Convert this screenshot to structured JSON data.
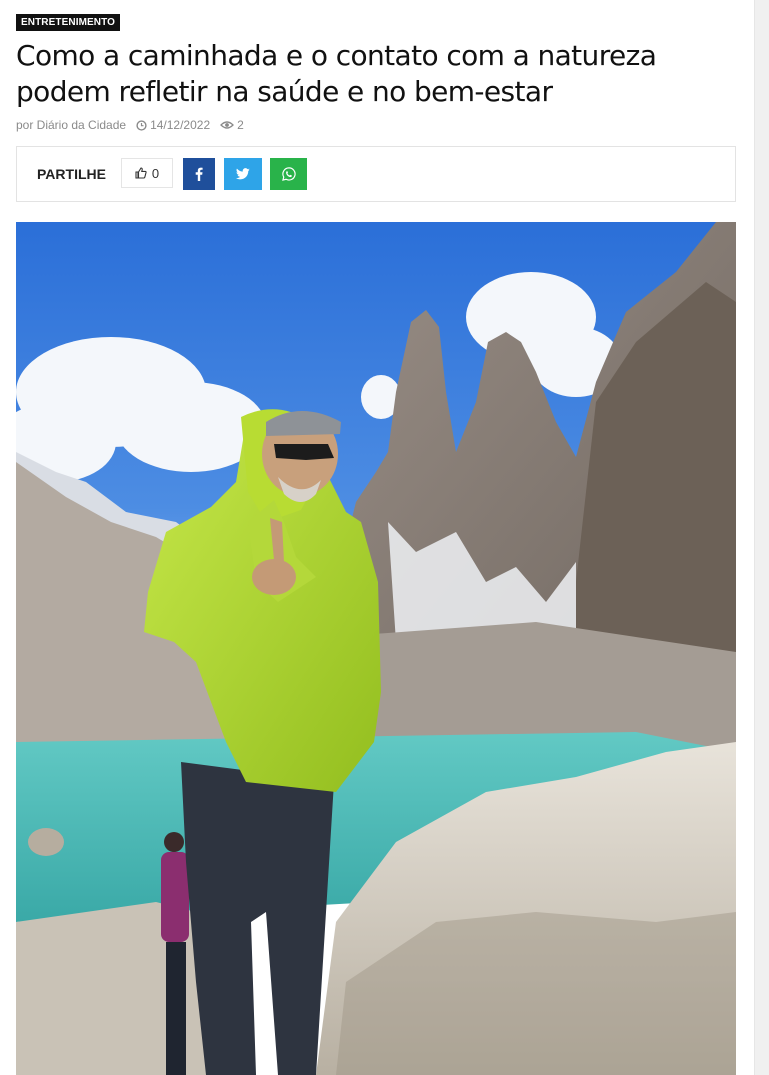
{
  "article": {
    "category": "ENTRETENIMENTO",
    "title": "Como a caminhada e o contato com a natureza podem refletir na saúde e no bem-estar",
    "author": "por Diário da Cidade",
    "date": "14/12/2022",
    "views": "2"
  },
  "share": {
    "label": "PARTILHE",
    "likes": "0",
    "buttons": [
      {
        "network": "facebook",
        "icon": "facebook-icon",
        "color": "#1f4f9b"
      },
      {
        "network": "twitter",
        "icon": "twitter-icon",
        "color": "#2ea4e8"
      },
      {
        "network": "whatsapp",
        "icon": "whatsapp-icon",
        "color": "#29b34a"
      }
    ]
  },
  "hero_image": {
    "subject": "hiker-in-green-jacket-at-mountain-lake"
  }
}
